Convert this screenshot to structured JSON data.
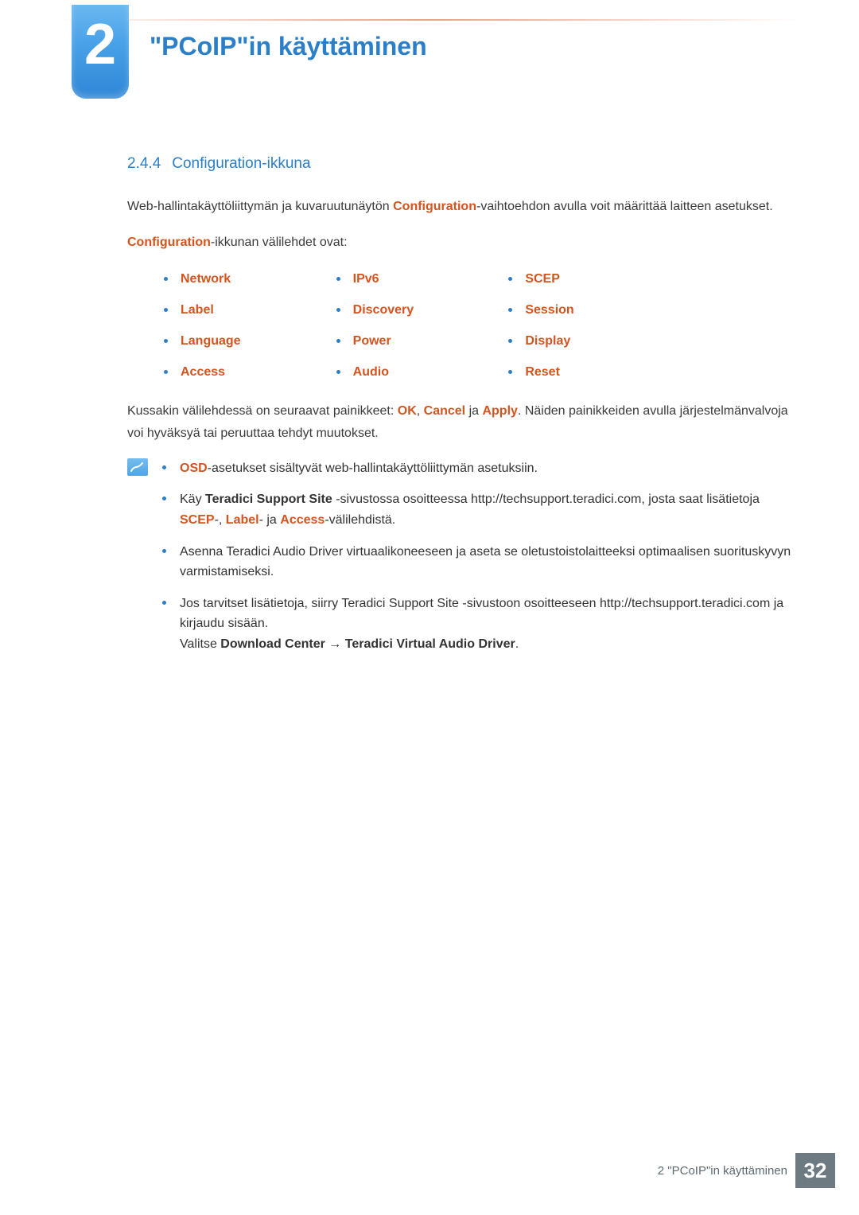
{
  "chapter": {
    "number": "2",
    "title": "\"PCoIP\"in käyttäminen"
  },
  "section": {
    "number": "2.4.4",
    "title": "Configuration-ikkuna"
  },
  "intro": {
    "pre": "Web-hallintakäyttöliittymän ja kuvaruutunäytön ",
    "hl": "Configuration",
    "post": "-vaihtoehdon avulla voit määrittää laitteen asetukset."
  },
  "tabs_intro": {
    "hl": "Configuration",
    "post": "-ikkunan välilehdet ovat:"
  },
  "tabs": [
    "Network",
    "IPv6",
    "SCEP",
    "Label",
    "Discovery",
    "Session",
    "Language",
    "Power",
    "Display",
    "Access",
    "Audio",
    "Reset"
  ],
  "buttons_sentence": {
    "pre": "Kussakin välilehdessä on seuraavat painikkeet: ",
    "ok": "OK",
    "sep1": ", ",
    "cancel": "Cancel",
    "sep2": " ja ",
    "apply": "Apply",
    "post": ". Näiden painikkeiden avulla järjestelmänvalvoja voi hyväksyä tai peruuttaa tehdyt muutokset."
  },
  "notes": {
    "n1": {
      "hl": "OSD",
      "post": "-asetukset sisältyvät web-hallintakäyttöliittymän asetuksiin."
    },
    "n2": {
      "pre": "Käy ",
      "bold": "Teradici Support Site",
      "mid": " -sivustossa osoitteessa http://techsupport.teradici.com, josta saat lisätietoja ",
      "scep": "SCEP",
      "dash1": "-, ",
      "label": "Label",
      "dash2": "- ja ",
      "access": "Access",
      "post": "-välilehdistä."
    },
    "n3": "Asenna Teradici Audio Driver virtuaalikoneeseen ja aseta se oletustoistolaitteeksi optimaalisen suorituskyvyn varmistamiseksi.",
    "n4": {
      "line1": "Jos tarvitset lisätietoja, siirry Teradici Support Site -sivustoon osoitteeseen http://techsupport.teradici.com ja kirjaudu sisään.",
      "choose_pre": "Valitse ",
      "dc": "Download Center",
      "arrow": " → ",
      "driver": "Teradici Virtual Audio Driver",
      "dot": "."
    }
  },
  "footer": {
    "text": "2 \"PCoIP\"in käyttäminen",
    "page": "32"
  }
}
